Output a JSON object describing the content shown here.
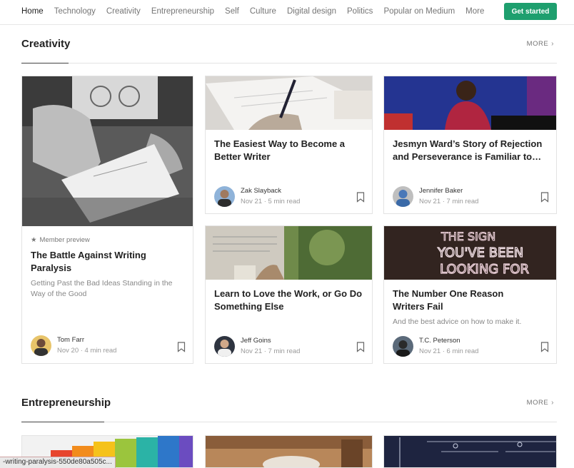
{
  "nav": {
    "items": [
      "Home",
      "Technology",
      "Creativity",
      "Entrepreneurship",
      "Self",
      "Culture",
      "Digital design",
      "Politics",
      "Popular on Medium",
      "More"
    ],
    "cta": "Get started"
  },
  "sections": [
    {
      "title": "Creativity",
      "more": "MORE"
    },
    {
      "title": "Entrepreneurship",
      "more": "MORE"
    }
  ],
  "cards": [
    {
      "member": "Member preview",
      "title": "The Battle Against Writing Paralysis",
      "subtitle": "Getting Past the Bad Ideas Standing in the Way of the Good",
      "author": "Tom Farr",
      "meta": "Nov 20 · 4 min read"
    },
    {
      "title": "The Easiest Way to Become a Better Writer",
      "author": "Zak Slayback",
      "meta": "Nov 21 · 5 min read"
    },
    {
      "title": "Jesmyn Ward’s Story of Rejection and Perseverance is Familiar to…",
      "author": "Jennifer Baker",
      "meta": "Nov 21 · 7 min read"
    },
    {
      "title": "Learn to Love the Work, or Go Do Something Else",
      "author": "Jeff Goins",
      "meta": "Nov 21 · 7 min read"
    },
    {
      "title": "The Number One Reason Writers Fail",
      "subtitle": "And the best advice on how to make it.",
      "author": "T.C. Peterson",
      "meta": "Nov 21 · 6 min read"
    }
  ],
  "status_url": "-writing-paralysis-550de80a505c..."
}
